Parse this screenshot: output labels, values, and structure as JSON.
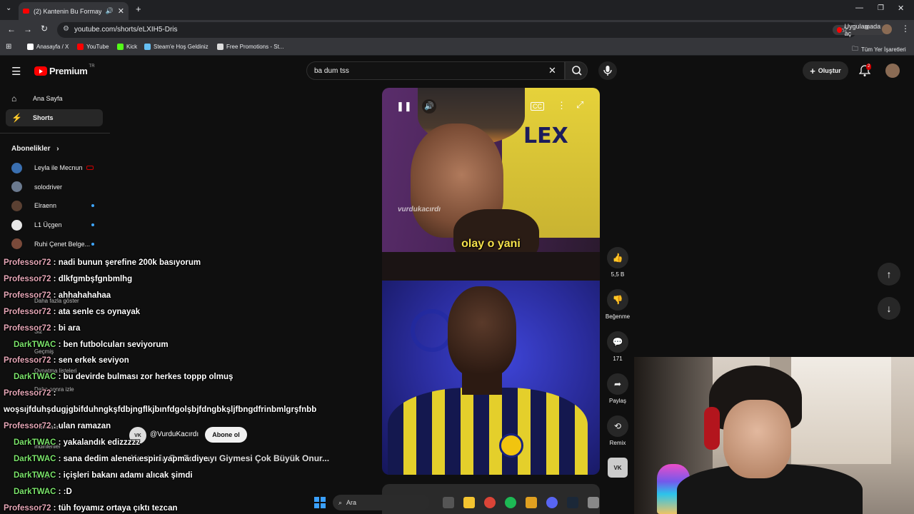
{
  "browser": {
    "tab_title": "(2) Kantenin Bu Formayı Giy...",
    "url": "youtube.com/shorts/eLXIH5-Dris",
    "open_in_app": "Uygulamada aç",
    "bookmarks": [
      {
        "label": "Anasayfa / X",
        "color": "#ffffff"
      },
      {
        "label": "YouTube",
        "color": "#ff0000"
      },
      {
        "label": "Kick",
        "color": "#53fc18"
      },
      {
        "label": "Steam'e Hoş Geldiniz",
        "color": "#66c0f4"
      },
      {
        "label": "Free Promotions - St...",
        "color": "#dddddd"
      }
    ],
    "all_bookmarks": "Tüm Yer İşaretleri"
  },
  "youtube": {
    "logo": "Premium",
    "logo_region": "TR",
    "search_query": "ba dum tss",
    "create_label": "Oluştur",
    "notification_count": "2",
    "sidebar": {
      "home": "Ana Sayfa",
      "shorts": "Shorts",
      "subscriptions_header": "Abonelikler",
      "subscriptions": [
        {
          "name": "Leyla ile Mecnun",
          "color": "#3a6fb0",
          "live": true,
          "new": false
        },
        {
          "name": "solodriver",
          "color": "#6b7a8f",
          "live": false,
          "new": false
        },
        {
          "name": "Elraenn",
          "color": "#5a4032",
          "live": false,
          "new": true
        },
        {
          "name": "L1 Üçgen",
          "color": "#e8e8e8",
          "live": false,
          "new": true
        },
        {
          "name": "Ruhi Çenet Belge...",
          "color": "#7a4a3a",
          "live": false,
          "new": true
        }
      ],
      "faint_items": [
        "Daha fazla göster",
        "Siz",
        "Geçmiş",
        "Oynatma listeleri",
        "Daha sonra izle",
        "Videolarınız",
        "İndirilenler",
        "Keşfet"
      ]
    },
    "short": {
      "watermark": "vurdukacırdı",
      "subtitle": "olay o yani",
      "channel_name": "@VurduKacırdı",
      "channel_initials": "VK",
      "subscribe_label": "Abone ol",
      "title": "Kantenin Bu Formayı Giymesi Çok Büyük Onur...",
      "likes": "5,5 B",
      "dislike_label": "Beğenme",
      "comments": "171",
      "share_label": "Paylaş",
      "remix_label": "Remix"
    }
  },
  "chat": [
    {
      "user": "Professor72",
      "msg": " : nadi bunun şerefine 200k basıyorum",
      "type": "p"
    },
    {
      "user": "Professor72",
      "msg": " : dlkfgmbşfgnbmlhg",
      "type": "p"
    },
    {
      "user": "Professor72",
      "msg": " : ahhahahahaa",
      "type": "p"
    },
    {
      "user": "Professor72",
      "msg": " : ata senle cs oynayak",
      "type": "p"
    },
    {
      "user": "Professor72",
      "msg": " : bi ara",
      "type": "p"
    },
    {
      "user": "DarkTWAC",
      "msg": " : ben futbolcuları seviyorum",
      "type": "d"
    },
    {
      "user": "Professor72",
      "msg": " : sen erkek seviyon",
      "type": "p"
    },
    {
      "user": "DarkTWAC",
      "msg": " : bu devirde bulması zor herkes toppp olmuş",
      "type": "d"
    },
    {
      "user": "Professor72",
      "msg": " :",
      "type": "p"
    },
    {
      "user": "",
      "msg": "woşsıjfduhşdugjgbifduhngkşfdbjngflkjbınfdgolşbjfdngbkşljfbngdfrinbmlgrşfnbb",
      "type": "p"
    },
    {
      "user": "Professor72",
      "msg": " : ulan ramazan",
      "type": "p"
    },
    {
      "user": "DarkTWAC",
      "msg": " : yakalandık edizzzzz",
      "type": "d"
    },
    {
      "user": "DarkTWAC",
      "msg": " : sana dedim alenen espiri yapma diye",
      "type": "d"
    },
    {
      "user": "DarkTWAC",
      "msg": " : içişleri bakanı adamı alıcak şimdi",
      "type": "d"
    },
    {
      "user": "DarkTWAC",
      "msg": " : :D",
      "type": "d"
    },
    {
      "user": "Professor72",
      "msg": " : tüh foyamız ortaya çıktı tezcan",
      "type": "p"
    }
  ],
  "taskbar": {
    "search": "Ara",
    "icons": [
      {
        "name": "files-icon",
        "color": "#555555"
      },
      {
        "name": "folder-icon",
        "color": "#f4c430"
      },
      {
        "name": "chrome-icon",
        "color": "#db4437"
      },
      {
        "name": "spotify-icon",
        "color": "#1db954"
      },
      {
        "name": "app-icon",
        "color": "#e0a020"
      },
      {
        "name": "discord-icon",
        "color": "#5865f2"
      },
      {
        "name": "steam-icon",
        "color": "#1b2838"
      },
      {
        "name": "settings-icon",
        "color": "#888888"
      }
    ]
  }
}
